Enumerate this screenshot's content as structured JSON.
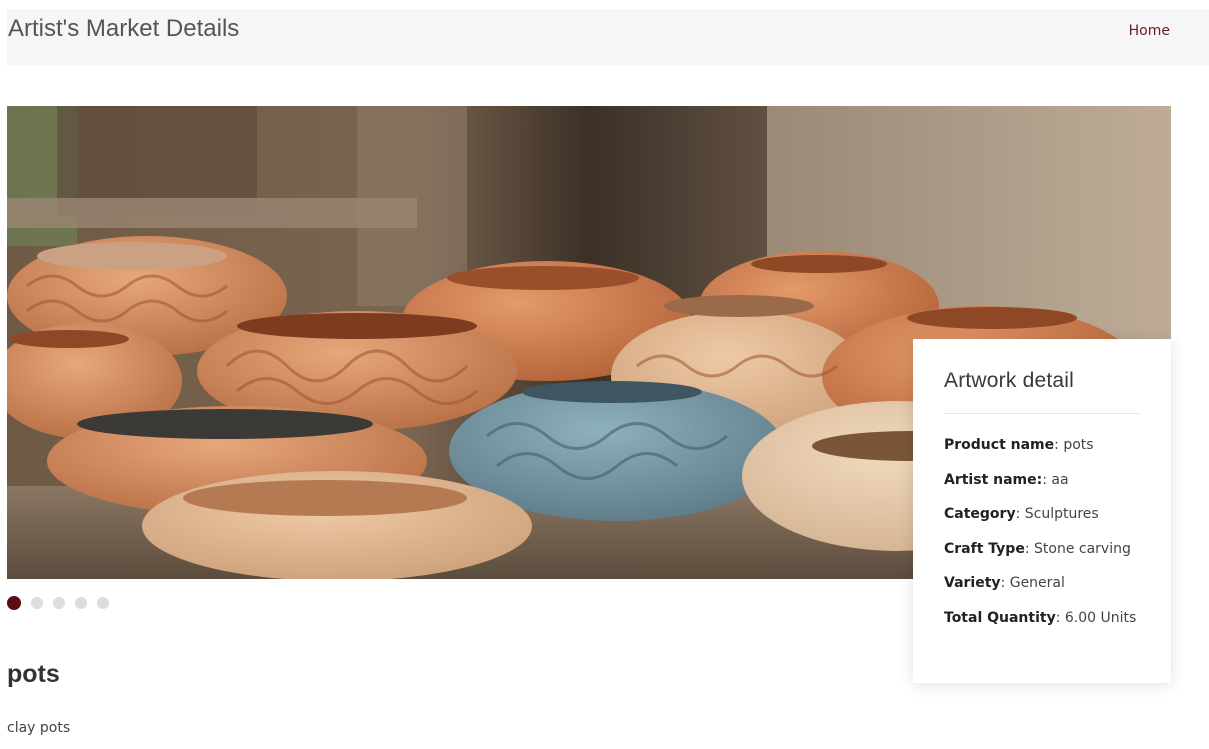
{
  "header": {
    "site_title": "Artist's Market Details",
    "nav": {
      "home_label": "Home"
    }
  },
  "hero": {
    "image_icon": "pottery-photo",
    "slide_count": 5,
    "active_slide": 1
  },
  "detail_card": {
    "title": "Artwork detail",
    "fields": [
      {
        "label": "Product name",
        "separator": ": ",
        "value": "pots"
      },
      {
        "label": "Artist name:",
        "separator": ": ",
        "value": "aa"
      },
      {
        "label": "Category",
        "separator": ": ",
        "value": "Sculptures"
      },
      {
        "label": "Craft Type",
        "separator": ": ",
        "value": "Stone carving"
      },
      {
        "label": "Variety",
        "separator": ": ",
        "value": "General"
      },
      {
        "label": "Total Quantity",
        "separator": ": ",
        "value": "6.00 Units"
      }
    ]
  },
  "product": {
    "title": "pots",
    "description": "clay pots"
  },
  "colors": {
    "accent": "#5b0d14",
    "nav_link": "#6a1d22",
    "topbar_bg": "#f6f6f6"
  }
}
